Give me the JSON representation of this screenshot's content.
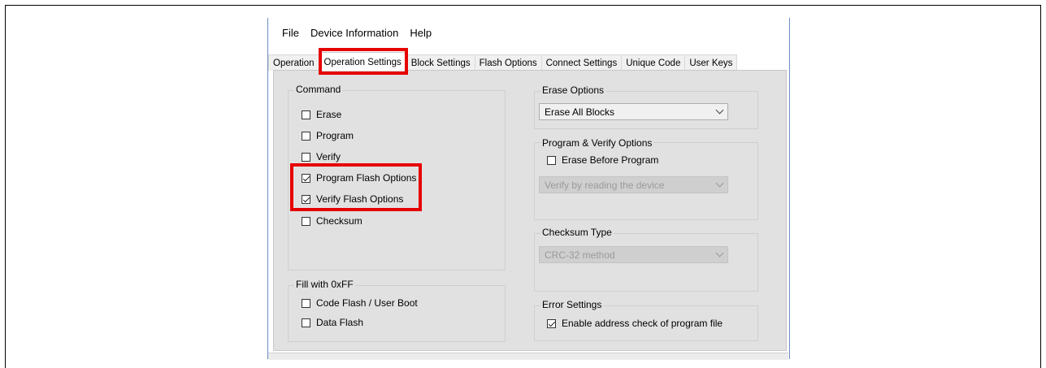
{
  "menu": [
    "File",
    "Device Information",
    "Help"
  ],
  "tabs": [
    "Operation",
    "Operation Settings",
    "Block Settings",
    "Flash Options",
    "Connect Settings",
    "Unique Code",
    "User Keys"
  ],
  "command": {
    "title": "Command",
    "items": [
      {
        "label": "Erase",
        "checked": false
      },
      {
        "label": "Program",
        "checked": false
      },
      {
        "label": "Verify",
        "checked": false
      },
      {
        "label": "Program Flash Options",
        "checked": true
      },
      {
        "label": "Verify Flash Options",
        "checked": true
      },
      {
        "label": "Checksum",
        "checked": false
      }
    ]
  },
  "fill": {
    "title": "Fill with 0xFF",
    "items": [
      {
        "label": "Code Flash / User Boot",
        "checked": false
      },
      {
        "label": "Data Flash",
        "checked": false
      }
    ]
  },
  "erase_options": {
    "title": "Erase Options",
    "value": "Erase All Blocks"
  },
  "program_verify": {
    "title": "Program & Verify Options",
    "erase_before_label": "Erase Before Program",
    "erase_before_checked": false,
    "verify_value": "Verify by reading the device"
  },
  "checksum_type": {
    "title": "Checksum Type",
    "value": "CRC-32 method"
  },
  "error_settings": {
    "title": "Error Settings",
    "enable_label": "Enable address check of program file",
    "enable_checked": true
  },
  "colors": {
    "highlight": "#e60000",
    "panel": "#e1e1e1"
  }
}
